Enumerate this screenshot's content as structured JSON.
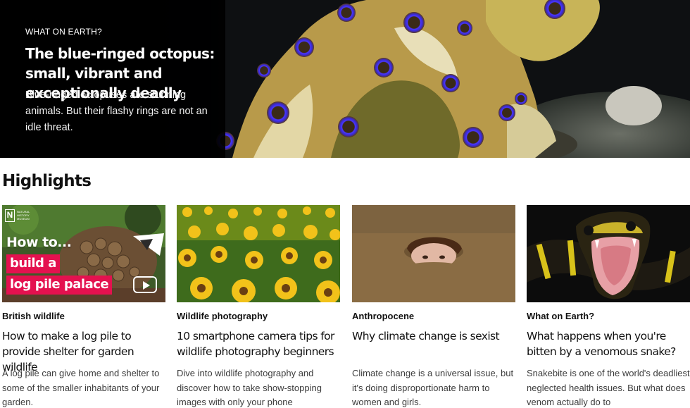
{
  "hero": {
    "kicker": "WHAT ON EARTH?",
    "title": "The blue-ringed octopus: small, vibrant and exceptionally deadly",
    "description": "Blue-ringed octopuses are stunning animals. But their flashy rings are not an idle threat."
  },
  "highlights": {
    "heading": "Highlights",
    "cards": [
      {
        "category": "British wildlife",
        "title": "How to make a log pile to provide shelter for garden wildlife",
        "description": "A log pile can give home and shelter to some of the smaller inhabitants of your garden.",
        "overlay": {
          "logo_letter": "N",
          "logo_text": "NATURAL HISTORY MUSEUM",
          "line1": "How to...",
          "line2": "build a",
          "line3": "log pile palace"
        }
      },
      {
        "category": "Wildlife photography",
        "title": "10 smartphone camera tips for wildlife photography beginners",
        "description": "Dive into wildlife photography and discover how to take show-stopping images with only your phone"
      },
      {
        "category": "Anthropocene",
        "title": "Why climate change is sexist",
        "description": "Climate change is a universal issue, but it's doing disproportionate harm to women and girls."
      },
      {
        "category": "What on Earth?",
        "title": "What happens when you're bitten by a venomous snake?",
        "description": "Snakebite is one of the world's deadliest neglected health issues. But what does venom actually do to"
      }
    ]
  },
  "colors": {
    "accent_pink": "#e4114f",
    "hero_panel": "#000000",
    "ring_blue": "#3b2bd6"
  }
}
